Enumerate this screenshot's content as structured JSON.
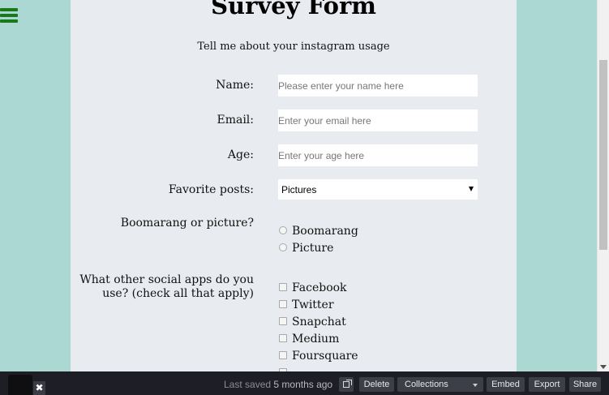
{
  "form": {
    "title": "Survey Form",
    "description": "Tell me about your instagram usage",
    "name": {
      "label": "Name:",
      "placeholder": "Please enter your name here"
    },
    "email": {
      "label": "Email:",
      "placeholder": "Enter your email here"
    },
    "age": {
      "label": "Age:",
      "placeholder": "Enter your age here"
    },
    "favorite": {
      "label": "Favorite posts:",
      "selected": "Pictures"
    },
    "boomerang": {
      "label": "Boomarang or picture?",
      "options": [
        "Boomarang",
        "Picture"
      ]
    },
    "apps": {
      "label_line1": "What other social apps do you",
      "label_line2": "use? (check all that apply)",
      "options": [
        "Facebook",
        "Twitter",
        "Snapchat",
        "Medium",
        "Foursquare"
      ]
    }
  },
  "bottom_bar": {
    "saved_prefix": "Last saved",
    "saved_time": "5 months ago",
    "delete": "Delete",
    "collections": "Collections",
    "embed": "Embed",
    "export": "Export",
    "share": "Share"
  },
  "colors": {
    "page_bg": "#acd8d3",
    "card_bg": "#e8ebef",
    "menu_icon": "#1a7a1a",
    "bar_bg": "#1e1f26"
  }
}
